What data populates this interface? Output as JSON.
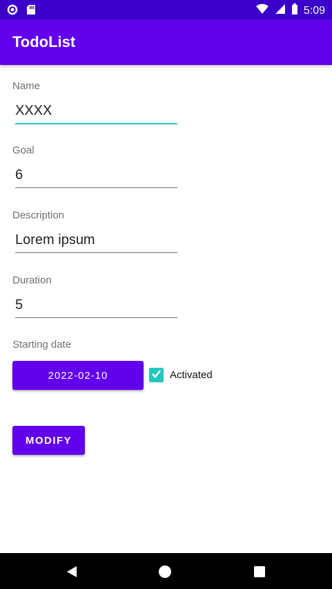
{
  "status_bar": {
    "time": "5:09",
    "icons": [
      "circle-notification-icon",
      "sd-card-icon",
      "wifi-icon",
      "signal-icon",
      "battery-icon"
    ]
  },
  "app_bar": {
    "title": "TodoList"
  },
  "form": {
    "name": {
      "label": "Name",
      "value": "XXXX"
    },
    "goal": {
      "label": "Goal",
      "value": "6"
    },
    "description": {
      "label": "Description",
      "value": "Lorem ipsum"
    },
    "duration": {
      "label": "Duration",
      "value": "5"
    },
    "starting_date": {
      "label": "Starting date",
      "value": "2022-02-10"
    },
    "activated": {
      "label": "Activated",
      "checked": true
    },
    "modify_label": "MODIFY"
  },
  "nav_bar": {
    "icons": [
      "back-icon",
      "home-icon",
      "recents-icon"
    ]
  },
  "colors": {
    "status_bar": "#3a00c9",
    "primary": "#6200ee",
    "accent": "#26c6bd"
  }
}
